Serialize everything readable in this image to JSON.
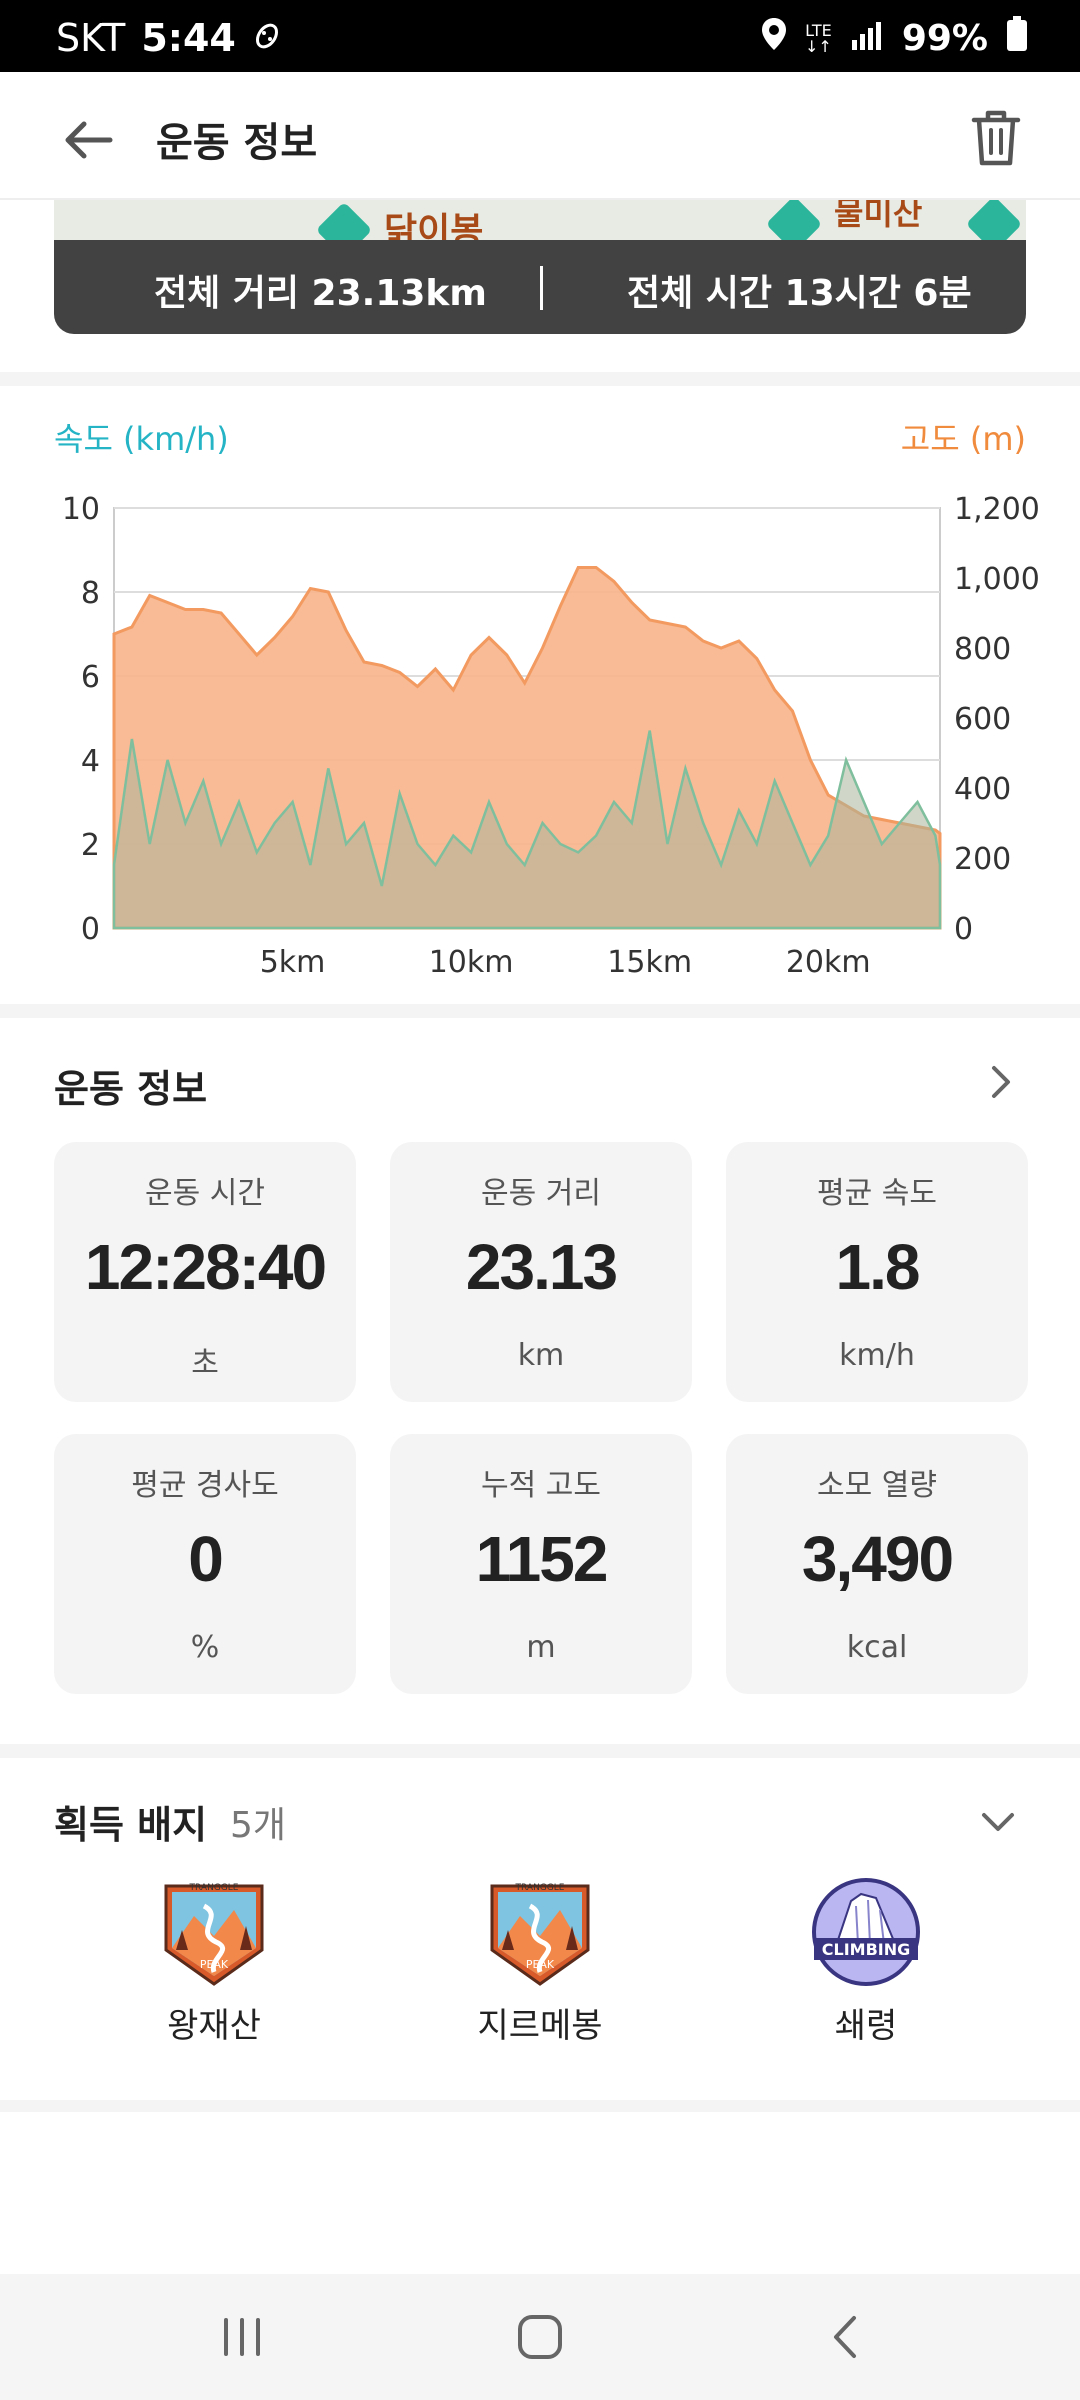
{
  "status_bar": {
    "carrier": "SKT",
    "time": "5:44",
    "network": "LTE",
    "battery": "99%"
  },
  "app_bar": {
    "title": "운동 정보"
  },
  "map": {
    "label_visible": "닭이봉",
    "label_right": "물미산"
  },
  "summary": {
    "distance": "전체 거리 23.13km",
    "time": "전체 시간 13시간 6분"
  },
  "chart": {
    "left_axis_title": "속도 (km/h)",
    "right_axis_title": "고도 (m)",
    "left_ticks": [
      "10",
      "8",
      "6",
      "4",
      "2",
      "0"
    ],
    "right_ticks": [
      "1,200",
      "1,000",
      "800",
      "600",
      "400",
      "200",
      "0"
    ],
    "x_ticks": [
      "5km",
      "10km",
      "15km",
      "20km"
    ],
    "colors": {
      "speed": "#7fbf9e",
      "elevation": "#f7b48a",
      "left_axis": "#25b4c6",
      "right_axis": "#f08a3c"
    }
  },
  "chart_data": {
    "type": "area",
    "xlabel": "",
    "x_range": [
      0,
      23.13
    ],
    "left_ylabel": "속도 (km/h)",
    "left_ylim": [
      0,
      10
    ],
    "right_ylabel": "고도 (m)",
    "right_ylim": [
      0,
      1200
    ],
    "x_ticks": [
      5,
      10,
      15,
      20
    ],
    "series": [
      {
        "name": "고도 (m)",
        "axis": "right",
        "x": [
          0,
          0.5,
          1,
          1.5,
          2,
          2.5,
          3,
          3.5,
          4,
          4.5,
          5,
          5.5,
          6,
          6.5,
          7,
          7.5,
          8,
          8.5,
          9,
          9.5,
          10,
          10.5,
          11,
          11.5,
          12,
          12.5,
          13,
          13.5,
          14,
          14.5,
          15,
          15.5,
          16,
          16.5,
          17,
          17.5,
          18,
          18.5,
          19,
          19.5,
          20,
          20.5,
          21,
          21.5,
          22,
          22.5,
          23,
          23.13
        ],
        "values": [
          840,
          860,
          950,
          930,
          910,
          910,
          900,
          840,
          780,
          830,
          890,
          970,
          960,
          850,
          760,
          750,
          730,
          690,
          740,
          680,
          780,
          830,
          780,
          700,
          800,
          920,
          1030,
          1030,
          990,
          930,
          880,
          870,
          860,
          820,
          800,
          820,
          770,
          680,
          620,
          480,
          380,
          350,
          320,
          310,
          300,
          290,
          280,
          270
        ]
      },
      {
        "name": "속도 (km/h)",
        "axis": "left",
        "x": [
          0,
          0.5,
          1,
          1.5,
          2,
          2.5,
          3,
          3.5,
          4,
          4.5,
          5,
          5.5,
          6,
          6.5,
          7,
          7.5,
          8,
          8.5,
          9,
          9.5,
          10,
          10.5,
          11,
          11.5,
          12,
          12.5,
          13,
          13.5,
          14,
          14.5,
          15,
          15.5,
          16,
          16.5,
          17,
          17.5,
          18,
          18.5,
          19,
          19.5,
          20,
          20.5,
          21,
          21.5,
          22,
          22.5,
          23,
          23.13
        ],
        "values": [
          1.5,
          4.5,
          2.0,
          4.0,
          2.5,
          3.5,
          2.0,
          3.0,
          1.8,
          2.5,
          3.0,
          1.5,
          3.8,
          2.0,
          2.5,
          1.0,
          3.2,
          2.0,
          1.5,
          2.2,
          1.8,
          3.0,
          2.0,
          1.5,
          2.5,
          2.0,
          1.8,
          2.2,
          3.0,
          2.5,
          4.7,
          2.0,
          3.8,
          2.5,
          1.5,
          2.8,
          2.0,
          3.5,
          2.5,
          1.5,
          2.2,
          4.0,
          3.0,
          2.0,
          2.5,
          3.0,
          2.2,
          1.5
        ]
      }
    ]
  },
  "workout": {
    "title": "운동 정보",
    "cards": [
      {
        "label": "운동 시간",
        "value": "12:28:40",
        "unit": "초"
      },
      {
        "label": "운동 거리",
        "value": "23.13",
        "unit": "km"
      },
      {
        "label": "평균 속도",
        "value": "1.8",
        "unit": "km/h"
      },
      {
        "label": "평균 경사도",
        "value": "0",
        "unit": "%"
      },
      {
        "label": "누적 고도",
        "value": "1152",
        "unit": "m"
      },
      {
        "label": "소모 열량",
        "value": "3,490",
        "unit": "kcal"
      }
    ]
  },
  "badges": {
    "title": "획득 배지",
    "count": "5개",
    "items": [
      {
        "name": "왕재산",
        "icon": "peak-badge-icon",
        "top_text": "TRANGGLE",
        "bottom_text": "PEAK"
      },
      {
        "name": "지르메봉",
        "icon": "peak-badge-icon",
        "top_text": "TRANGGLE",
        "bottom_text": "PEAK"
      },
      {
        "name": "쇄령",
        "icon": "climbing-badge-icon",
        "top_text": "CLIMBING",
        "bottom_text": ""
      }
    ]
  }
}
